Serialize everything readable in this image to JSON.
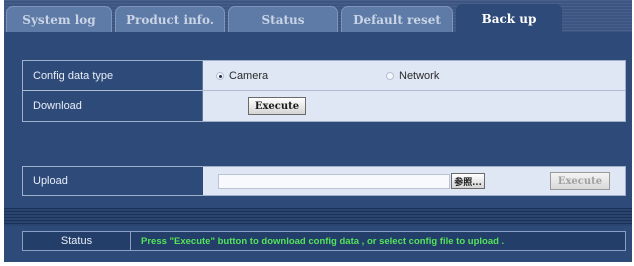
{
  "tabs": [
    {
      "label": "System log",
      "active": false
    },
    {
      "label": "Product info.",
      "active": false
    },
    {
      "label": "Status",
      "active": false
    },
    {
      "label": "Default reset",
      "active": false
    },
    {
      "label": "Back up",
      "active": true
    }
  ],
  "config": {
    "type_label": "Config data type",
    "options": [
      {
        "label": "Camera",
        "selected": true
      },
      {
        "label": "Network",
        "selected": false
      }
    ],
    "download_label": "Download",
    "download_button": "Execute"
  },
  "upload": {
    "label": "Upload",
    "file_value": "",
    "browse_button": "参照...",
    "execute_button": "Execute"
  },
  "status": {
    "label": "Status",
    "message": "Press \"Execute\" button to download config data , or select config file to upload ."
  },
  "colors": {
    "background": "#2e4a78",
    "status_text": "#54e35a"
  }
}
